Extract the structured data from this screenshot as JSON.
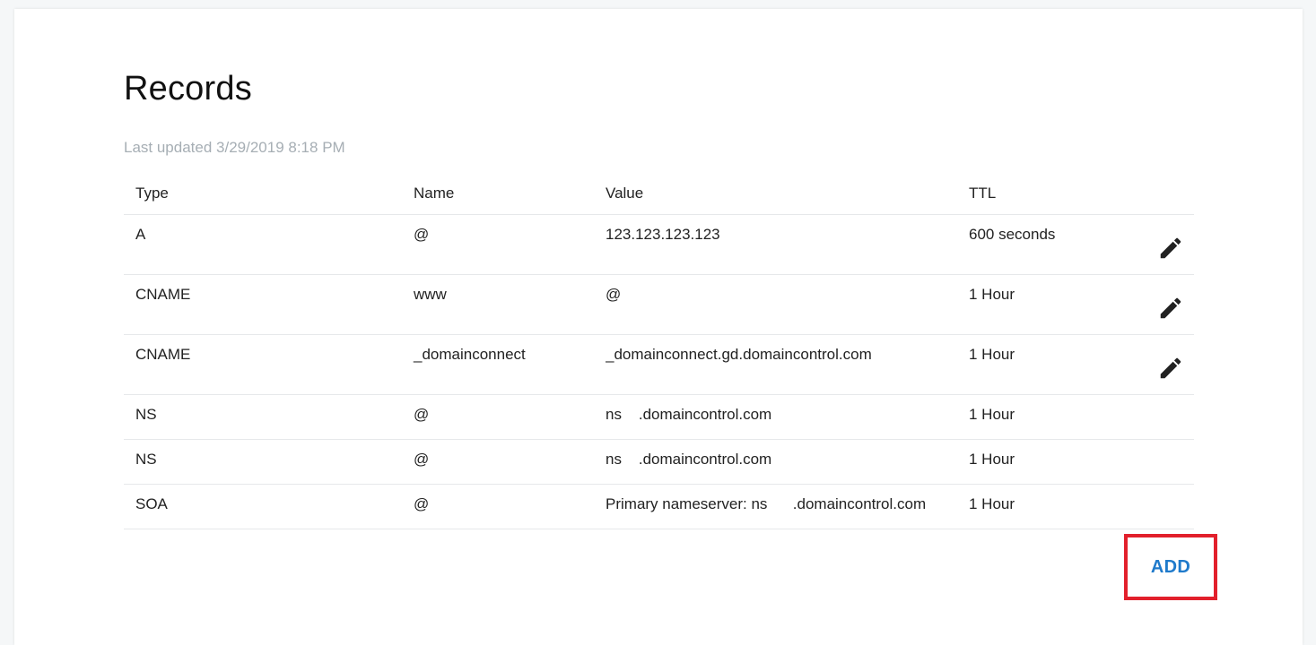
{
  "page": {
    "title": "Records",
    "last_updated": "Last updated 3/29/2019 8:18 PM"
  },
  "table": {
    "headers": [
      "Type",
      "Name",
      "Value",
      "TTL"
    ],
    "rows": [
      {
        "type": "A",
        "name": "@",
        "value": "123.123.123.123",
        "ttl": "600 seconds",
        "editable": true
      },
      {
        "type": "CNAME",
        "name": "www",
        "value": "@",
        "ttl": "1 Hour",
        "editable": true
      },
      {
        "type": "CNAME",
        "name": "_domainconnect",
        "value": "_domainconnect.gd.domaincontrol.com",
        "ttl": "1 Hour",
        "editable": true
      },
      {
        "type": "NS",
        "name": "@",
        "value": "ns    .domaincontrol.com",
        "ttl": "1 Hour",
        "editable": false
      },
      {
        "type": "NS",
        "name": "@",
        "value": "ns    .domaincontrol.com",
        "ttl": "1 Hour",
        "editable": false
      },
      {
        "type": "SOA",
        "name": "@",
        "value": "Primary nameserver: ns      .domaincontrol.com",
        "ttl": "1 Hour",
        "editable": false
      }
    ]
  },
  "actions": {
    "add_label": "ADD",
    "edit_icon": "pencil-icon"
  },
  "colors": {
    "accent": "#1f7acb",
    "highlight": "#e2202c",
    "muted_text": "#a6aeb4"
  }
}
